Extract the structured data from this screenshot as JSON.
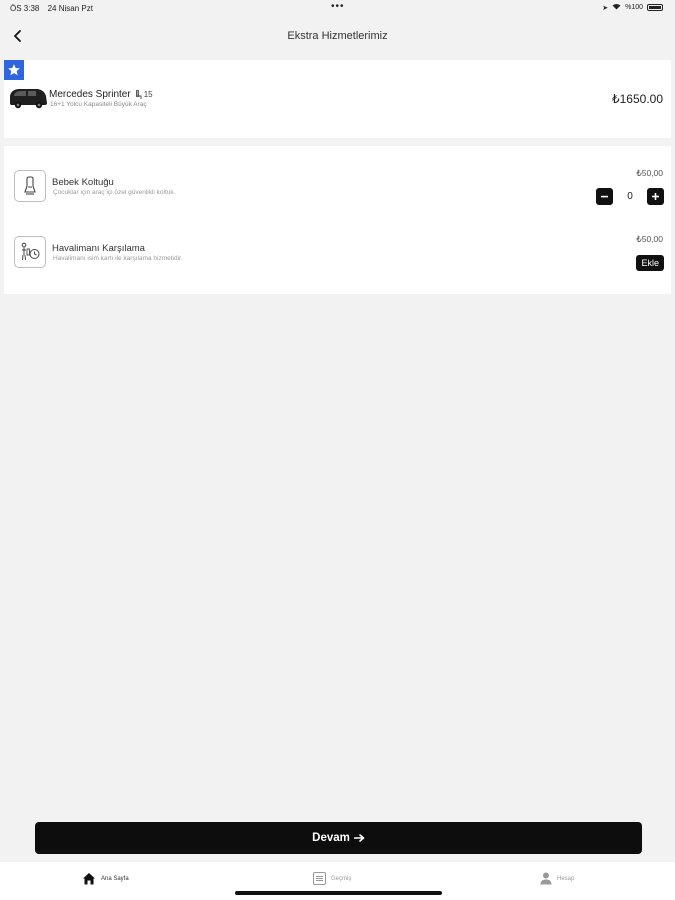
{
  "status_bar": {
    "time": "ÖS 3:38",
    "date": "24 Nisan Pzt",
    "battery_text": "%100"
  },
  "header": {
    "title": "Ekstra Hizmetlerimiz"
  },
  "vehicle": {
    "name": "Mercedes Sprinter",
    "seats": "15",
    "subtitle": "16+1 Yolcu Kapasiteli Büyük Araç",
    "price": "₺1650.00"
  },
  "extras": [
    {
      "name": "Bebek Koltuğu",
      "description": "Çocuklar için araç içi özel güvenlikli koltuk.",
      "price": "₺50,00",
      "quantity": "0"
    },
    {
      "name": "Havalimanı Karşılama",
      "description": "Havalimanı isim kartı ile karşılama hizmetidir.",
      "price": "₺50,00",
      "add_label": "Ekle"
    }
  ],
  "continue_button": {
    "label": "Devam"
  },
  "tab_bar": {
    "tabs": [
      {
        "label": "Ana Sayfa",
        "active": true
      },
      {
        "label": "Geçmiş",
        "active": false
      },
      {
        "label": "Hesap",
        "active": false
      }
    ]
  },
  "colors": {
    "accent": "#2f66e0",
    "button": "#0d0d0d",
    "background": "#f2f2f2"
  }
}
